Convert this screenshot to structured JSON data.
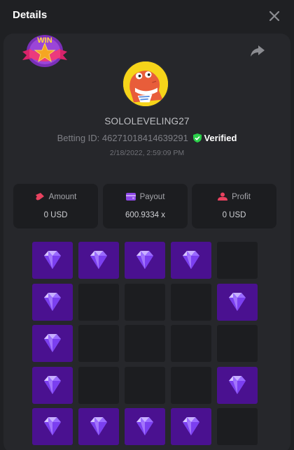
{
  "header": {
    "title": "Details"
  },
  "badge": {
    "text": "WIN"
  },
  "player": {
    "username": "SOLOLEVELING27",
    "betting_id_label": "Betting ID:",
    "betting_id": "46271018414639291",
    "verified_label": "Verified",
    "datetime": "2/18/2022, 2:59:09 PM"
  },
  "stats": [
    {
      "label": "Amount",
      "value": "0 USD",
      "icon": "amount-icon",
      "color": "#e8425f"
    },
    {
      "label": "Payout",
      "value": "600.9334 x",
      "icon": "wallet-icon",
      "color": "#8e48e8"
    },
    {
      "label": "Profit",
      "value": "0 USD",
      "icon": "profit-icon",
      "color": "#e8425f"
    }
  ],
  "grid": {
    "rows": 5,
    "cols": 5,
    "cells": [
      "gem",
      "gem",
      "gem",
      "gem",
      "empty",
      "gem",
      "empty",
      "empty",
      "empty",
      "gem",
      "gem",
      "empty",
      "empty",
      "empty",
      "empty",
      "gem",
      "empty",
      "empty",
      "empty",
      "gem",
      "gem",
      "gem",
      "gem",
      "gem",
      "empty"
    ]
  },
  "colors": {
    "gem_tile": "#4a1190",
    "empty_tile": "#1c1d20",
    "verified_green": "#2bd04a"
  }
}
